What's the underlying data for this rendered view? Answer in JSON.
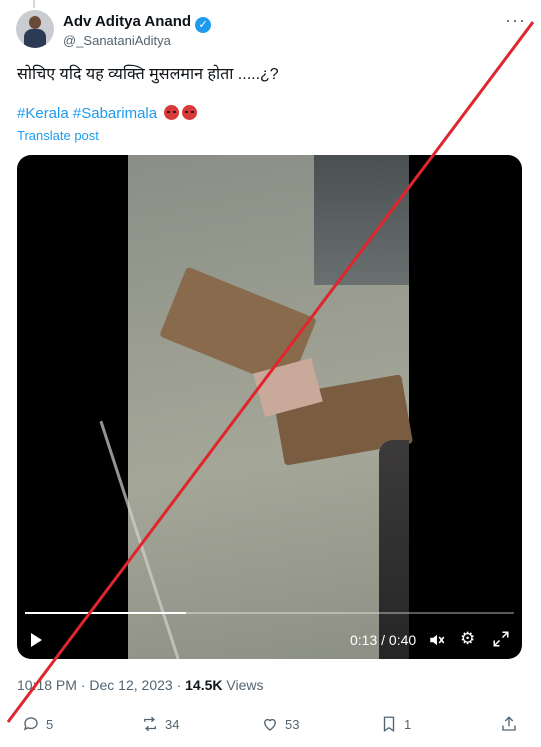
{
  "author": {
    "name": "Adv Aditya Anand",
    "handle": "@_SanataniAditya",
    "verified": true
  },
  "more_label": "···",
  "tweet": {
    "text": "सोचिए यदि यह व्यक्ति मुसलमान होता .....¿?",
    "hashtag1": "#Kerala",
    "hashtag2": "#Sabarimala",
    "emoji": [
      "angry-face",
      "angry-face"
    ],
    "translate_label": "Translate post"
  },
  "video": {
    "time_display": "0:13 / 0:40",
    "progress": 0.33
  },
  "meta": {
    "time": "10:18 PM",
    "separator": "·",
    "date": "Dec 12, 2023",
    "views_count": "14.5K",
    "views_label": "Views"
  },
  "actions": {
    "replies": "5",
    "reposts": "34",
    "likes": "53",
    "bookmarks": "1"
  },
  "colors": {
    "accent": "#1d9bf0",
    "overlay_line": "#e0252c"
  }
}
